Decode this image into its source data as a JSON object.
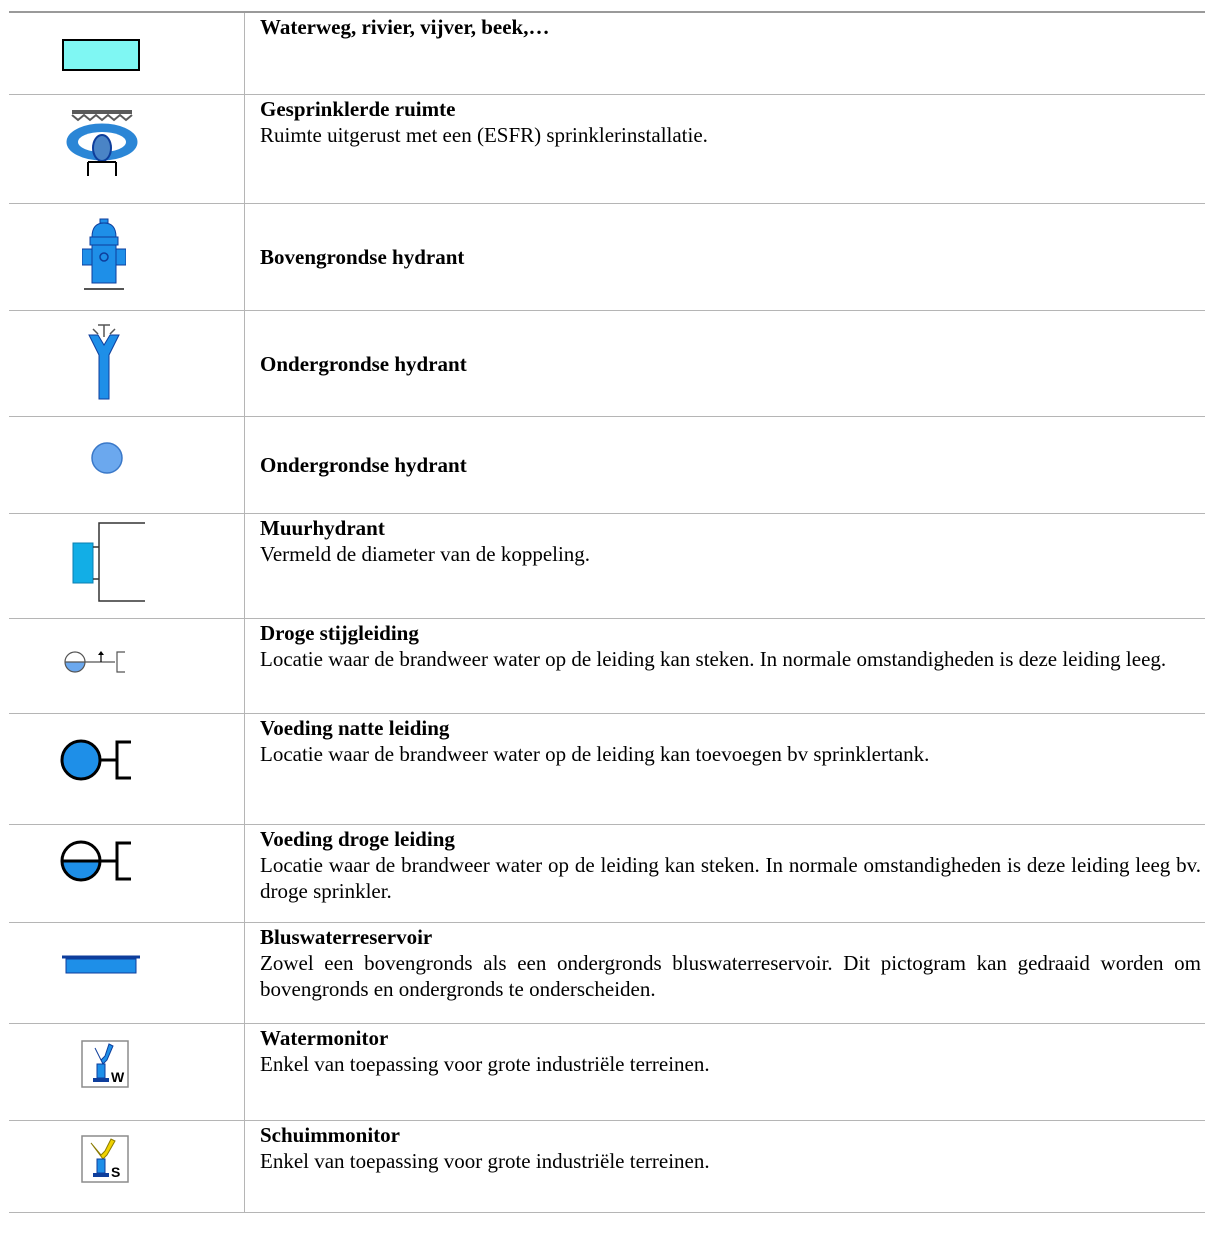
{
  "colors": {
    "water_light": "#7ff7f3",
    "blue": "#1e8fe8",
    "blue_light": "#6ba8ee",
    "cyan": "#12aee6",
    "dark_blue": "#0e3e9c",
    "yellow": "#f0d200",
    "border": "#b5b5b5"
  },
  "rows": [
    {
      "icon": "waterway-icon",
      "title": "Waterweg, rivier, vijver, beek,…",
      "desc": ""
    },
    {
      "icon": "sprinkler-icon",
      "title": "Gesprinklerde ruimte",
      "desc": "Ruimte uitgerust met een  (ESFR) sprinklerinstallatie."
    },
    {
      "icon": "aboveground-hydrant-icon",
      "title": "Bovengrondse hydrant",
      "desc": ""
    },
    {
      "icon": "underground-hydrant-icon",
      "title": "Ondergrondse hydrant",
      "desc": ""
    },
    {
      "icon": "underground-hydrant-circle-icon",
      "title": "Ondergrondse hydrant",
      "desc": ""
    },
    {
      "icon": "wall-hydrant-icon",
      "title": "Muurhydrant",
      "desc": " Vermeld de diameter van de koppeling."
    },
    {
      "icon": "dry-riser-icon",
      "title": "Droge stijgleiding",
      "desc": "Locatie waar de brandweer water op de leiding kan steken. In normale omstandigheden is deze leiding leeg."
    },
    {
      "icon": "wet-supply-icon",
      "title": "Voeding natte leiding",
      "desc": "Locatie waar de brandweer water op de leiding kan toevoegen bv sprinklertank."
    },
    {
      "icon": "dry-supply-icon",
      "title": "Voeding droge leiding",
      "desc": "Locatie waar de brandweer water op de leiding kan steken. In normale omstandigheden is deze leiding leeg bv. droge sprinkler."
    },
    {
      "icon": "reservoir-icon",
      "title": "Bluswaterreservoir",
      "desc": "Zowel een bovengronds als een ondergronds bluswaterreservoir. Dit pictogram kan gedraaid worden om bovengronds en ondergronds te onderscheiden."
    },
    {
      "icon": "water-monitor-icon",
      "title": "Watermonitor",
      "desc": "Enkel van toepassing voor grote industriële terreinen.",
      "badge": "W"
    },
    {
      "icon": "foam-monitor-icon",
      "title": "Schuimmonitor",
      "desc": "Enkel van toepassing voor grote industriële terreinen.",
      "badge": "S"
    }
  ]
}
